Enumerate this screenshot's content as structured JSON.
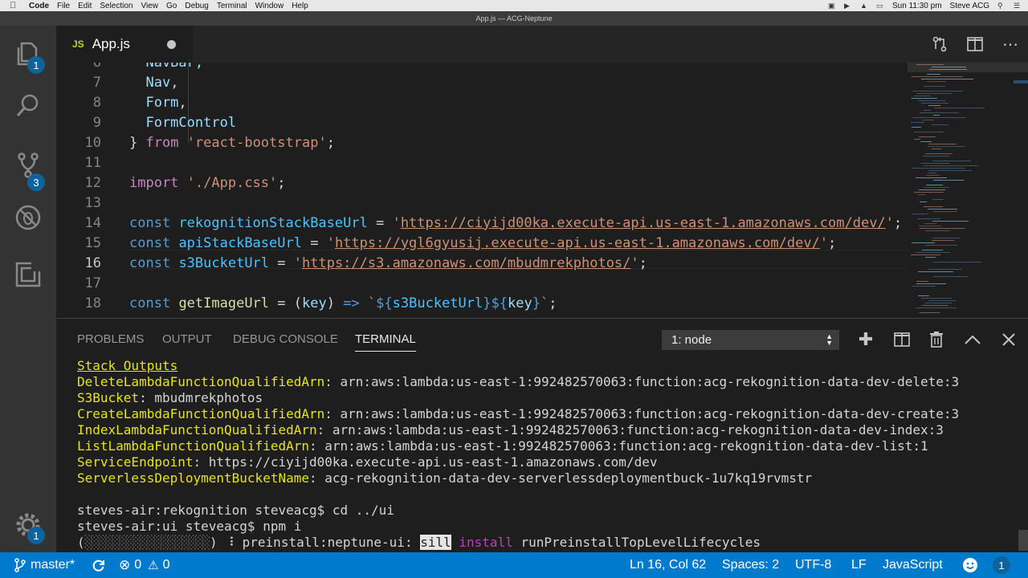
{
  "menubar": {
    "app": "Code",
    "items": [
      "File",
      "Edit",
      "Selection",
      "View",
      "Go",
      "Debug",
      "Terminal",
      "Window",
      "Help"
    ],
    "clock": "Sun 11:30 pm",
    "user": "Steve ACG"
  },
  "window": {
    "title": "App.js — ACG-Neptune"
  },
  "activity": {
    "explorer_badge": "1",
    "scm_badge": "3",
    "settings_badge": "1"
  },
  "tab": {
    "icon": "JS",
    "name": "App.js"
  },
  "editor": {
    "lines": [
      {
        "n": "7",
        "tokens": [
          [
            "v",
            "  Nav"
          ],
          [
            "p",
            ","
          ]
        ]
      },
      {
        "n": "8",
        "tokens": [
          [
            "v",
            "  Form"
          ],
          [
            "p",
            ","
          ]
        ]
      },
      {
        "n": "9",
        "tokens": [
          [
            "v",
            "  FormControl"
          ]
        ]
      },
      {
        "n": "10",
        "tokens": [
          [
            "p",
            "} "
          ],
          [
            "kf",
            "from"
          ],
          [
            "p",
            " "
          ],
          [
            "s",
            "'react-bootstrap'"
          ],
          [
            "p",
            ";"
          ]
        ]
      },
      {
        "n": "11",
        "tokens": []
      },
      {
        "n": "12",
        "tokens": [
          [
            "kf",
            "import"
          ],
          [
            "p",
            " "
          ],
          [
            "s",
            "'./App.css'"
          ],
          [
            "p",
            ";"
          ]
        ]
      },
      {
        "n": "13",
        "tokens": []
      },
      {
        "n": "14",
        "tokens": [
          [
            "k",
            "const"
          ],
          [
            "p",
            " "
          ],
          [
            "c",
            "rekognitionStackBaseUrl"
          ],
          [
            "p",
            " = "
          ],
          [
            "s",
            "'"
          ],
          [
            "u",
            "https://ciyijd00ka.execute-api.us-east-1.amazonaws.com/dev/"
          ],
          [
            "s",
            "'"
          ],
          [
            "p",
            ";"
          ]
        ]
      },
      {
        "n": "15",
        "tokens": [
          [
            "k",
            "const"
          ],
          [
            "p",
            " "
          ],
          [
            "c",
            "apiStackBaseUrl"
          ],
          [
            "p",
            " = "
          ],
          [
            "s",
            "'"
          ],
          [
            "u",
            "https://ygl6gyusij.execute-api.us-east-1.amazonaws.com/dev/"
          ],
          [
            "s",
            "'"
          ],
          [
            "p",
            ";"
          ]
        ]
      },
      {
        "n": "16",
        "tokens": [
          [
            "k",
            "const"
          ],
          [
            "p",
            " "
          ],
          [
            "c",
            "s3BucketUrl"
          ],
          [
            "p",
            " = "
          ],
          [
            "s",
            "'"
          ],
          [
            "u",
            "https://s3.amazonaws.com/mbudmrekphotos/"
          ],
          [
            "s",
            "'"
          ],
          [
            "p",
            ";"
          ]
        ]
      },
      {
        "n": "17",
        "tokens": []
      },
      {
        "n": "18",
        "tokens": [
          [
            "k",
            "const"
          ],
          [
            "p",
            " "
          ],
          [
            "y",
            "getImageUrl"
          ],
          [
            "p",
            " = ("
          ],
          [
            "v",
            "key"
          ],
          [
            "p",
            ") "
          ],
          [
            "k",
            "=>"
          ],
          [
            "p",
            " "
          ],
          [
            "s",
            "`"
          ],
          [
            "k",
            "${"
          ],
          [
            "c",
            "s3BucketUrl"
          ],
          [
            "k",
            "}${"
          ],
          [
            "v",
            "key"
          ],
          [
            "k",
            "}"
          ],
          [
            "s",
            "`"
          ],
          [
            "p",
            ";"
          ]
        ]
      }
    ],
    "partial_top": "  NavBar,",
    "cursor_line": "16"
  },
  "panel": {
    "tabs": [
      "PROBLEMS",
      "OUTPUT",
      "DEBUG CONSOLE",
      "TERMINAL"
    ],
    "active_tab": "TERMINAL",
    "terminal_select": "1: node"
  },
  "terminal": {
    "heading": "Stack Outputs",
    "outputs": [
      {
        "k": "DeleteLambdaFunctionQualifiedArn",
        "v": "arn:aws:lambda:us-east-1:992482570063:function:acg-rekognition-data-dev-delete:3"
      },
      {
        "k": "S3Bucket",
        "v": "mbudmrekphotos"
      },
      {
        "k": "CreateLambdaFunctionQualifiedArn",
        "v": "arn:aws:lambda:us-east-1:992482570063:function:acg-rekognition-data-dev-create:3"
      },
      {
        "k": "IndexLambdaFunctionQualifiedArn",
        "v": "arn:aws:lambda:us-east-1:992482570063:function:acg-rekognition-data-dev-index:3"
      },
      {
        "k": "ListLambdaFunctionQualifiedArn",
        "v": "arn:aws:lambda:us-east-1:992482570063:function:acg-rekognition-data-dev-list:1"
      },
      {
        "k": "ServiceEndpoint",
        "v": "https://ciyijd00ka.execute-api.us-east-1.amazonaws.com/dev"
      },
      {
        "k": "ServerlessDeploymentBucketName",
        "v": "acg-rekognition-data-dev-serverlessdeploymentbuck-1u7kq19rvmstr"
      }
    ],
    "cmd1": "steves-air:rekognition steveacg$ cd ../ui",
    "cmd2": "steves-air:ui steveacg$ npm i",
    "progress_open": "(",
    "progress_bar": "░░░░░░░░░░░░░░░░░░",
    "progress_close": ") ⠸ preinstall:neptune-ui: ",
    "sill": "sill",
    "install": "install",
    "lifecycle": " runPreinstallTopLevelLifecycles"
  },
  "status": {
    "branch": "master*",
    "errors": "0",
    "warnings": "0",
    "position": "Ln 16, Col 62",
    "spaces": "Spaces: 2",
    "encoding": "UTF-8",
    "eol": "LF",
    "language": "JavaScript",
    "notifications": "1"
  },
  "colors": {
    "accent": "#007acc",
    "badge": "#0e639c",
    "terminal_yellow": "#e5e510"
  }
}
